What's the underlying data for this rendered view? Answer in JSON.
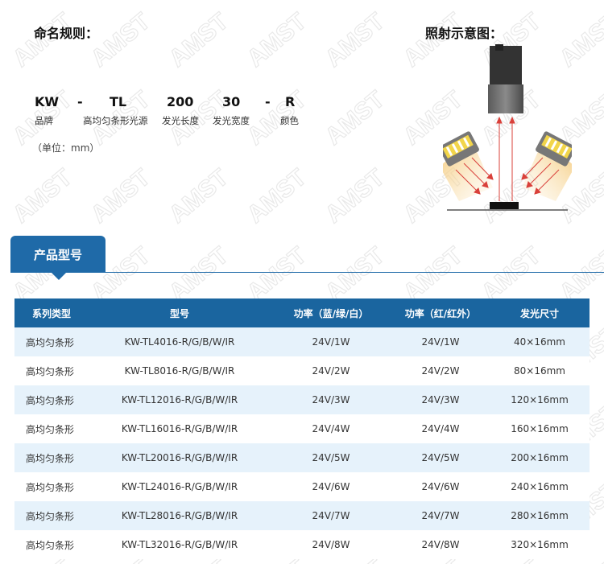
{
  "naming": {
    "title": "命名规则：",
    "parts": [
      {
        "code": "KW",
        "desc": "品牌"
      },
      {
        "code": "-",
        "desc": ""
      },
      {
        "code": "TL",
        "desc": "高均匀条形光源"
      },
      {
        "code": "200",
        "desc": "发光长度"
      },
      {
        "code": "30",
        "desc": "发光宽度"
      },
      {
        "code": "-",
        "desc": ""
      },
      {
        "code": "R",
        "desc": "颜色"
      }
    ],
    "unit_note": "（单位：mm）"
  },
  "diagram": {
    "title": "照射示意图："
  },
  "section": {
    "tab_label": "产品型号"
  },
  "table": {
    "headers": [
      "系列类型",
      "型号",
      "功率（蓝/绿/白）",
      "功率（红/红外）",
      "发光尺寸"
    ],
    "rows": [
      [
        "高均匀条形",
        "KW-TL4016-R/G/B/W/IR",
        "24V/1W",
        "24V/1W",
        "40×16mm"
      ],
      [
        "高均匀条形",
        "KW-TL8016-R/G/B/W/IR",
        "24V/2W",
        "24V/2W",
        "80×16mm"
      ],
      [
        "高均匀条形",
        "KW-TL12016-R/G/B/W/IR",
        "24V/3W",
        "24V/3W",
        "120×16mm"
      ],
      [
        "高均匀条形",
        "KW-TL16016-R/G/B/W/IR",
        "24V/4W",
        "24V/4W",
        "160×16mm"
      ],
      [
        "高均匀条形",
        "KW-TL20016-R/G/B/W/IR",
        "24V/5W",
        "24V/5W",
        "200×16mm"
      ],
      [
        "高均匀条形",
        "KW-TL24016-R/G/B/W/IR",
        "24V/6W",
        "24V/6W",
        "240×16mm"
      ],
      [
        "高均匀条形",
        "KW-TL28016-R/G/B/W/IR",
        "24V/7W",
        "24V/7W",
        "280×16mm"
      ],
      [
        "高均匀条形",
        "KW-TL32016-R/G/B/W/IR",
        "24V/8W",
        "24V/8W",
        "320×16mm"
      ]
    ]
  },
  "watermark": {
    "text": "AMST"
  },
  "colors": {
    "header_blue": "#1a659f",
    "tab_blue": "#1f6aa8",
    "row_tint": "#e6f2fb",
    "light_beam": "#f3c36a",
    "beam_arrow": "#d9403a"
  }
}
